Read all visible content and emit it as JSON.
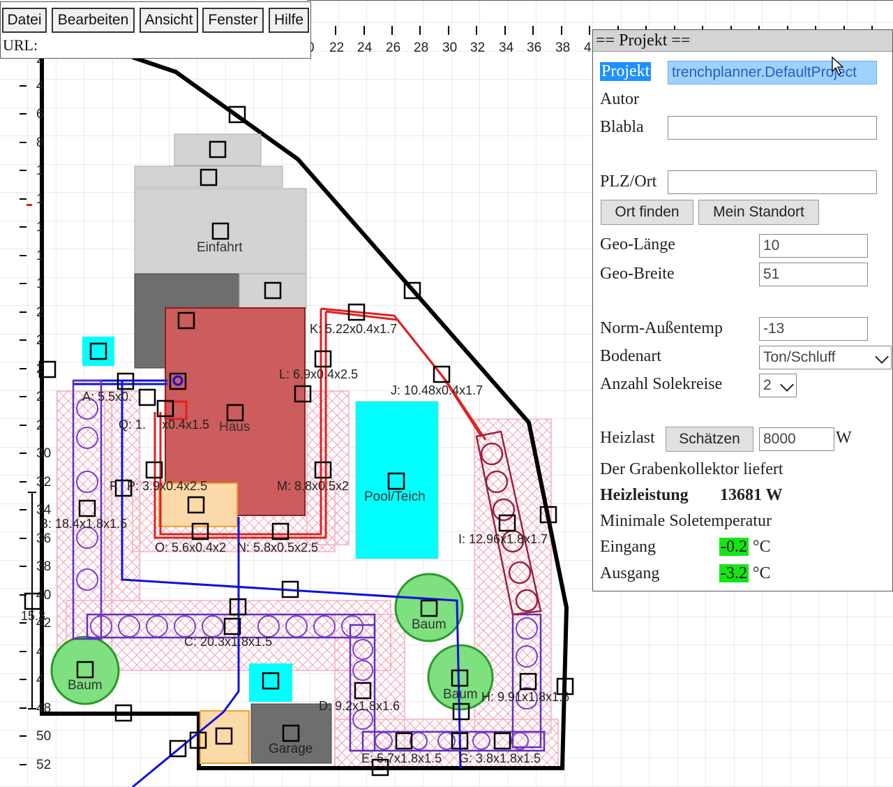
{
  "menu": {
    "items": [
      {
        "label": "Datei"
      },
      {
        "label": "Bearbeiten"
      },
      {
        "label": "Ansicht"
      },
      {
        "label": "Fenster"
      },
      {
        "label": "Hilfe"
      }
    ],
    "url_label": "URL:"
  },
  "ruler": {
    "top_ticks": [
      "0",
      "22",
      "24",
      "26",
      "28",
      "30",
      "32",
      "34",
      "36",
      "38",
      "4"
    ],
    "left_ticks": [
      "2",
      "4",
      "6",
      "8",
      "1",
      "1",
      "1",
      "1",
      "1",
      "2",
      "2",
      "2",
      "2",
      "2",
      "30",
      "32",
      "34",
      "36",
      "38",
      "40",
      "42",
      "4",
      "4",
      "48",
      "50",
      "52"
    ],
    "scale_value": "15.3"
  },
  "plan": {
    "labels": {
      "einfahrt": "Einfahrt",
      "haus": "Haus",
      "pool": "Pool/Teich",
      "baum1": "Baum",
      "baum2": "Baum",
      "baum3": "Baum",
      "garage": "Garage",
      "trench_a": "A: 5.5x0.",
      "trench_b": "B: 18.4x1.8x1.5",
      "trench_c": "C: 20.3x1.8x1.5",
      "trench_d": "D: 9.2x1.8x1.6",
      "trench_e": "E: 5.7x1.8x1.5",
      "trench_g": "G: 3.8x1.8x1.5",
      "trench_h": "H: 9.91x1.8x1.6",
      "trench_i": "I: 12.96x1.8x1.7",
      "trench_j": "J: 10.48x0.4x1.7",
      "trench_k": "K: 5.22x0.4x1.7",
      "trench_l": "L: 6.9x0.4x2.5",
      "trench_m": "M: 8.8x0.5x2",
      "trench_n": "N: 5.8x0.5x2.5",
      "trench_o": "O: 5.6x0.4x2",
      "trench_p": "P: 3.9x0.4x2.5",
      "trench_q": "Q: 1.",
      "trench_q2": "x0.4x1.5",
      "trench_f": "F"
    }
  },
  "project_panel": {
    "title": "== Projekt ==",
    "projekt_label": "Projekt",
    "projekt_value": "trenchplanner.DefaultProject",
    "autor_label": "Autor",
    "blabla_label": "Blabla",
    "blabla_value": "",
    "plz_label": "PLZ/Ort",
    "plz_value": "",
    "ort_finden_label": "Ort finden",
    "mein_standort_label": "Mein Standort",
    "geo_laenge_label": "Geo-Länge",
    "geo_laenge_value": "10",
    "geo_breite_label": "Geo-Breite",
    "geo_breite_value": "51",
    "norm_label": "Norm-Außentemp",
    "norm_value": "-13",
    "bodenart_label": "Bodenart",
    "bodenart_value": "Ton/Schluff",
    "solekreise_label": "Anzahl Solekreise",
    "solekreise_value": "2",
    "heizlast_label": "Heizlast",
    "schaetzen_label": "Schätzen",
    "heizlast_value": "8000",
    "heizlast_unit": "W",
    "liefert_text": "Der Grabenkollektor liefert",
    "heizleistung_label": "Heizleistung",
    "heizleistung_value": "13681 W",
    "min_sole_text": "Minimale Soletemperatur",
    "eingang_label": "Eingang",
    "eingang_value": "-0.2",
    "eingang_unit": "°C",
    "ausgang_label": "Ausgang",
    "ausgang_value": "-3.2",
    "ausgang_unit": "°C"
  },
  "colors": {
    "house": "#cd5c5c",
    "pool": "#00ffff",
    "tree": "#7fe07f",
    "driveway": "#d3d3d3",
    "garage": "#6e6e6e",
    "trench_red": "#e02020",
    "trench_blue": "#3030e0",
    "trench_purple": "#8040c0",
    "hatch_pink": "#f4a0b4",
    "highlight_green": "#14e614",
    "selection_blue": "#1e90ff"
  }
}
